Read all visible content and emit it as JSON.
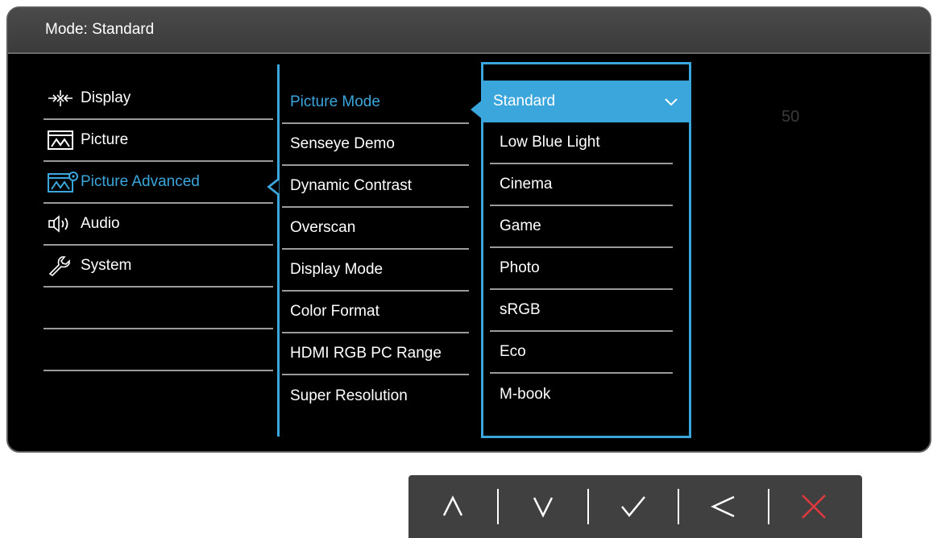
{
  "osd": {
    "title": "Mode: Standard",
    "value_readout": "50"
  },
  "main_menu": {
    "items": [
      {
        "label": "Display",
        "icon": "display-icon"
      },
      {
        "label": "Picture",
        "icon": "picture-icon"
      },
      {
        "label": "Picture Advanced",
        "icon": "picture-advanced-icon",
        "active": true
      },
      {
        "label": "Audio",
        "icon": "audio-icon"
      },
      {
        "label": "System",
        "icon": "system-wrench-icon"
      }
    ]
  },
  "sub_menu": {
    "items": [
      {
        "label": "Picture Mode",
        "active": true
      },
      {
        "label": "Senseye Demo"
      },
      {
        "label": "Dynamic Contrast"
      },
      {
        "label": "Overscan"
      },
      {
        "label": "Display Mode"
      },
      {
        "label": "Color Format"
      },
      {
        "label": "HDMI RGB PC Range"
      },
      {
        "label": "Super Resolution"
      }
    ]
  },
  "options": {
    "items": [
      {
        "label": "Standard",
        "selected": true
      },
      {
        "label": "Low Blue Light"
      },
      {
        "label": "Cinema"
      },
      {
        "label": "Game"
      },
      {
        "label": "Photo"
      },
      {
        "label": "sRGB"
      },
      {
        "label": "Eco"
      },
      {
        "label": "M-book"
      }
    ]
  },
  "control_keys": [
    {
      "name": "up-key",
      "icon": "chevron-up-icon"
    },
    {
      "name": "down-key",
      "icon": "chevron-down-icon"
    },
    {
      "name": "ok-key",
      "icon": "check-icon"
    },
    {
      "name": "back-key",
      "icon": "chevron-left-icon"
    },
    {
      "name": "exit-key",
      "icon": "close-icon"
    }
  ],
  "colors": {
    "accent": "#3aa6dc",
    "exit": "#e0393e",
    "background": "#000000",
    "header": "#404040"
  }
}
